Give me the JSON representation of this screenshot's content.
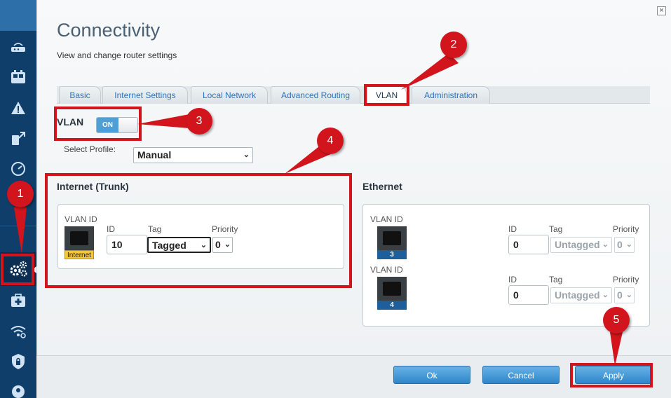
{
  "page": {
    "title": "Connectivity",
    "subtitle": "View and change router settings",
    "close_glyph": "×"
  },
  "sidebar": {
    "items": [
      {
        "icon": "router-icon"
      },
      {
        "icon": "devices-icon"
      },
      {
        "icon": "network-map-icon"
      },
      {
        "icon": "external-storage-icon"
      },
      {
        "icon": "speed-test-icon"
      },
      {
        "icon": "media-icon"
      },
      {
        "icon": "settings-gears-icon",
        "active": true
      },
      {
        "icon": "troubleshooting-icon"
      },
      {
        "icon": "wireless-icon"
      },
      {
        "icon": "security-icon"
      },
      {
        "icon": "user-icon"
      }
    ]
  },
  "tabs": [
    {
      "label": "Basic"
    },
    {
      "label": "Internet Settings"
    },
    {
      "label": "Local Network"
    },
    {
      "label": "Advanced Routing"
    },
    {
      "label": "VLAN",
      "active": true
    },
    {
      "label": "Administration"
    }
  ],
  "vlan": {
    "label": "VLAN",
    "toggle_state": "ON",
    "profile_label": "Select Profile:",
    "profile_value": "Manual"
  },
  "internet": {
    "title": "Internet (Trunk)",
    "vlan_id_label": "VLAN ID",
    "port_label": "Internet",
    "id_label": "ID",
    "tag_label": "Tag",
    "priority_label": "Priority",
    "id_value": "10",
    "tag_value": "Tagged",
    "priority_value": "0"
  },
  "ethernet": {
    "title": "Ethernet",
    "ports": [
      {
        "vlan_id_label": "VLAN ID",
        "port_number": "3",
        "id_label": "ID",
        "tag_label": "Tag",
        "priority_label": "Priority",
        "id_value": "0",
        "tag_value": "Untagged",
        "priority_value": "0"
      },
      {
        "vlan_id_label": "VLAN ID",
        "port_number": "4",
        "id_label": "ID",
        "tag_label": "Tag",
        "priority_label": "Priority",
        "id_value": "0",
        "tag_value": "Untagged",
        "priority_value": "0"
      }
    ]
  },
  "footer": {
    "ok_label": "Ok",
    "cancel_label": "Cancel",
    "apply_label": "Apply"
  },
  "annotations": {
    "steps": [
      "1",
      "2",
      "3",
      "4",
      "5"
    ],
    "color": "#d2141d"
  },
  "colors": {
    "sidebar": "#0f3e6b",
    "accent": "#2f86c9",
    "link": "#2f73b8"
  }
}
